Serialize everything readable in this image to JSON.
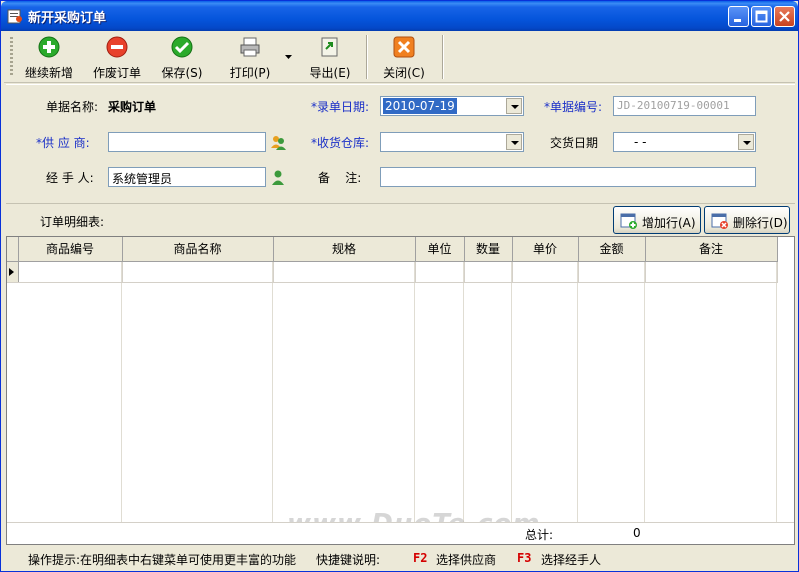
{
  "window": {
    "title": "新开采购订单"
  },
  "toolbar": {
    "add_label": "继续新增",
    "void_label": "作废订单",
    "save_label": "保存(S)",
    "print_label": "打印(P)",
    "export_label": "导出(E)",
    "close_label": "关闭(C)"
  },
  "form": {
    "doc_name_label": "单据名称:",
    "doc_name_value": "采购订单",
    "entry_date_label": "*录单日期:",
    "entry_date_value": "2010-07-19",
    "doc_no_label": "*单据编号:",
    "doc_no_value": "JD-20100719-00001",
    "supplier_label": "*供 应 商:",
    "supplier_value": "",
    "warehouse_label": "*收货仓库:",
    "warehouse_value": "",
    "delivery_date_label": "交货日期",
    "delivery_date_value": "- -",
    "handler_label": "经 手 人:",
    "handler_value": "系统管理员",
    "remark_label": "备    注:",
    "remark_value": ""
  },
  "detail": {
    "title": "订单明细表:",
    "add_row_label": "增加行(A)",
    "delete_row_label": "删除行(D)",
    "columns": [
      "商品编号",
      "商品名称",
      "规格",
      "单位",
      "数量",
      "单价",
      "金额",
      "备注"
    ],
    "total_label": "总计:",
    "total_value": "0"
  },
  "status": {
    "tip": "操作提示:在明细表中右键菜单可使用更丰富的功能",
    "shortcut_label": "快捷键说明:",
    "f2_key": "F2",
    "f2_desc": "选择供应商",
    "f3_key": "F3",
    "f3_desc": "选择经手人"
  },
  "watermark": "www.DuoTe.com",
  "colors": {
    "accent": "#0A5FE8",
    "required": "#1A2FC8",
    "hotkey": "#D40000"
  }
}
